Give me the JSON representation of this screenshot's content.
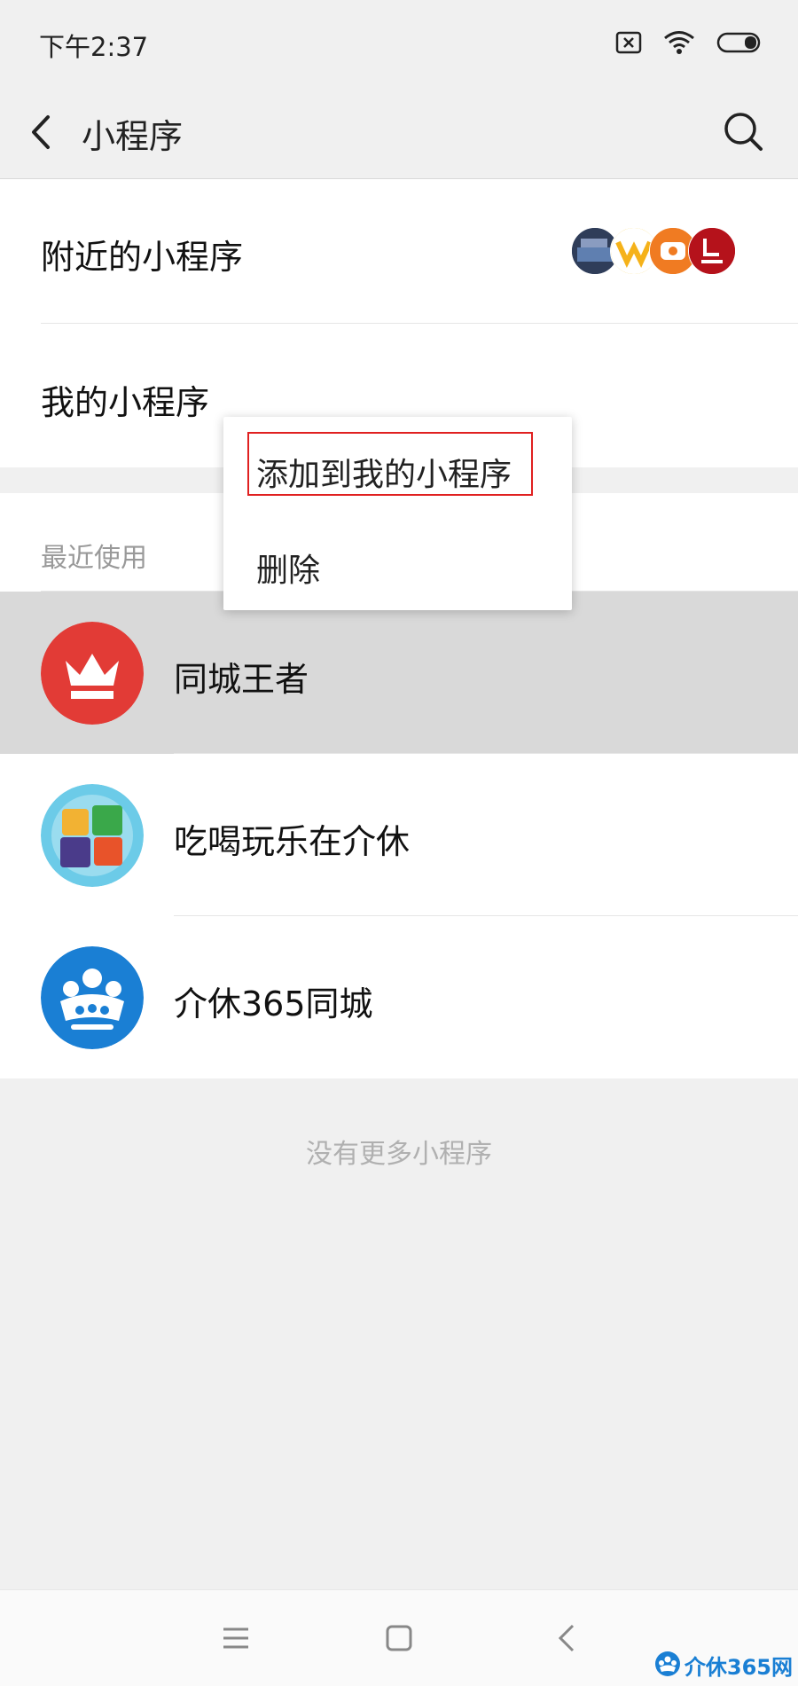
{
  "status_bar": {
    "time": "下午2:37",
    "icons": [
      "sim-off-icon",
      "wifi-icon",
      "battery-icon"
    ]
  },
  "nav": {
    "title": "小程序",
    "back_icon": "back-arrow-icon",
    "search_icon": "search-icon"
  },
  "sections": {
    "nearby_label": "附近的小程序",
    "mine_label": "我的小程序",
    "recent_header": "最近使用"
  },
  "recent_apps": [
    {
      "name": "同城王者",
      "icon": "crown-icon",
      "color": "#e23b36",
      "pressed": true
    },
    {
      "name": "吃喝玩乐在介休",
      "icon": "chihe-wanle-icon",
      "color": "#5bc2e8",
      "pressed": false
    },
    {
      "name": "介休365同城",
      "icon": "jiexiu-logo-icon",
      "color": "#1a7fd4",
      "pressed": false
    }
  ],
  "footer": {
    "text": "没有更多小程序"
  },
  "context_menu": {
    "items": [
      {
        "label": "添加到我的小程序",
        "highlighted": true
      },
      {
        "label": "删除",
        "highlighted": false
      }
    ]
  },
  "bottom_nav": {
    "icons": [
      "menu-icon",
      "home-icon",
      "back-icon"
    ]
  },
  "watermark": {
    "text": "介休365网"
  },
  "colors": {
    "highlight_border": "#e02020",
    "pressed_row": "#d9d9d9",
    "brand_blue": "#1a7fd4"
  }
}
